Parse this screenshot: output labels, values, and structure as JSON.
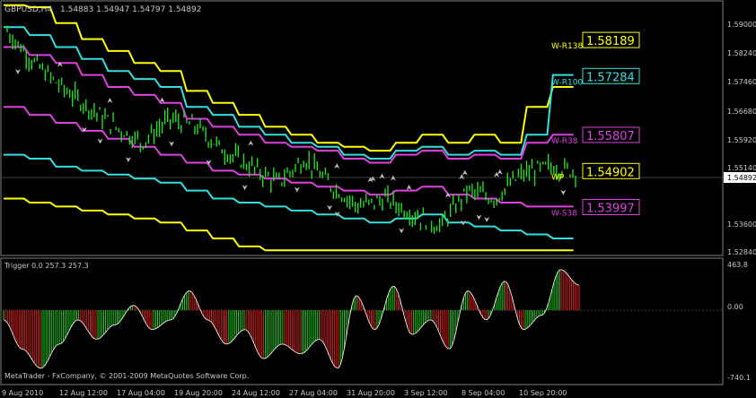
{
  "header": {
    "symbol_label": "GBPUSD,H4",
    "ohlc": "1.54883 1.54947 1.54797 1.54892"
  },
  "price_axis": {
    "ticks": [
      "1.59000",
      "1.58240",
      "1.57460",
      "1.56680",
      "1.55920",
      "1.55140",
      "1.54892",
      "1.53600",
      "1.52840"
    ],
    "current_price": "1.54892"
  },
  "level_labels": [
    {
      "name": "W-R138",
      "price": "1.58189",
      "color": "#ffff00"
    },
    {
      "name": "W-R100",
      "price": "1.57284",
      "color": "#33e0e0"
    },
    {
      "name": "W-R38",
      "price": "1.55807",
      "color": "#e040e0"
    },
    {
      "name": "WP",
      "price": "1.54902",
      "color": "#ffff00"
    },
    {
      "name": "W-S38",
      "price": "1.53997",
      "color": "#e040e0"
    }
  ],
  "indicator": {
    "label": "Trigger 0.0 257.3 257.3",
    "axis_ticks": [
      "463.8",
      "0.00",
      "-740.1"
    ]
  },
  "copyright": "MetaTrader - FxCompany, © 2001-2009 MetaQuotes Software Corp.",
  "time_axis": [
    "9 Aug 2010",
    "12 Aug 12:00",
    "17 Aug 04:00",
    "19 Aug 20:00",
    "24 Aug 12:00",
    "27 Aug 04:00",
    "31 Aug 20:00",
    "3 Sep 12:00",
    "8 Sep 04:00",
    "10 Sep 20:00"
  ],
  "colors": {
    "candle": "#22dd22",
    "yellow_band": "#ffff00",
    "cyan_band": "#33e0e0",
    "magenta_band": "#e040e0",
    "hist_up": "#22cc22",
    "hist_down": "#dd2222",
    "arrow": "#c0c0c0"
  },
  "chart_data": {
    "type": "line",
    "price_range": [
      1.5284,
      1.59
    ],
    "indicator_range": [
      -740.1,
      463.8
    ],
    "bands": {
      "yellow_upper": [
        1.5905,
        1.59,
        1.586,
        1.582,
        1.579,
        1.576,
        1.574,
        1.569,
        1.566,
        1.563,
        1.56,
        1.558,
        1.556,
        1.555,
        1.554,
        1.556,
        1.558,
        1.556,
        1.558,
        1.556,
        1.565,
        1.57
      ],
      "cyan_upper": [
        1.585,
        1.583,
        1.58,
        1.577,
        1.574,
        1.572,
        1.57,
        1.565,
        1.563,
        1.56,
        1.558,
        1.556,
        1.555,
        1.553,
        1.552,
        1.554,
        1.555,
        1.553,
        1.554,
        1.553,
        1.558,
        1.573
      ],
      "magenta_upper": [
        1.58,
        1.578,
        1.576,
        1.573,
        1.57,
        1.568,
        1.566,
        1.562,
        1.56,
        1.558,
        1.556,
        1.555,
        1.554,
        1.552,
        1.551,
        1.553,
        1.554,
        1.552,
        1.553,
        1.552,
        1.556,
        1.558
      ],
      "magenta_lower": [
        1.565,
        1.563,
        1.561,
        1.559,
        1.557,
        1.555,
        1.553,
        1.551,
        1.549,
        1.548,
        1.547,
        1.546,
        1.545,
        1.544,
        1.543,
        1.544,
        1.545,
        1.543,
        1.542,
        1.541,
        1.54,
        1.54
      ],
      "cyan_lower": [
        1.553,
        1.552,
        1.55,
        1.549,
        1.548,
        1.547,
        1.546,
        1.544,
        1.542,
        1.541,
        1.54,
        1.539,
        1.538,
        1.537,
        1.536,
        1.537,
        1.538,
        1.536,
        1.535,
        1.534,
        1.533,
        1.532
      ],
      "yellow_lower": [
        1.542,
        1.541,
        1.54,
        1.539,
        1.538,
        1.537,
        1.536,
        1.534,
        1.532,
        1.53,
        1.529,
        1.529,
        1.529,
        1.529,
        1.529,
        1.529,
        1.529,
        1.529,
        1.529,
        1.529,
        1.529,
        1.529
      ]
    },
    "price_path": [
      1.584,
      1.576,
      1.57,
      1.565,
      1.56,
      1.556,
      1.562,
      1.56,
      1.554,
      1.55,
      1.546,
      1.552,
      1.545,
      1.54,
      1.542,
      1.538,
      1.535,
      1.544,
      1.542,
      1.548,
      1.55,
      1.5489
    ],
    "indicator_path": [
      -100,
      -400,
      -600,
      -350,
      -100,
      -300,
      -150,
      50,
      -200,
      -100,
      200,
      -100,
      -350,
      -200,
      -500,
      -350,
      -450,
      -300,
      -600,
      150,
      -200,
      250,
      -250,
      -100,
      -400,
      200,
      -100,
      300,
      -200,
      -50,
      420,
      260
    ]
  }
}
